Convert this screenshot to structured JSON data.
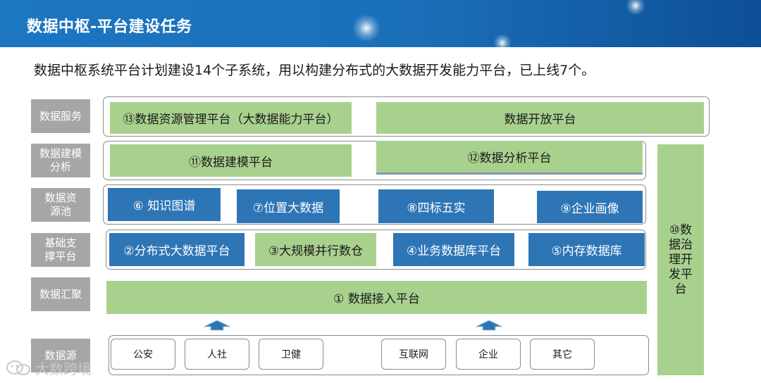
{
  "header": {
    "title": "数据中枢-平台建设任务"
  },
  "subtitle": "数据中枢系统平台计划建设14个子系统，用以构建分布式的大数据开发能力平台，已上线7个。",
  "layers": {
    "service": "数据服务",
    "modeling": "数据建模分析",
    "resource": "数据资源池",
    "foundation": "基础支撑平台",
    "aggregation": "数据汇聚",
    "source": "数据源"
  },
  "boxes": {
    "b13": "⑬数据资源管理平台（大数据能力平台）",
    "open": "数据开放平台",
    "b11": "⑪数据建模平台",
    "b12": "⑫数据分析平台",
    "b6": "⑥ 知识图谱",
    "b7": "⑦位置大数据",
    "b8": "⑧四标五实",
    "b9": "⑨企业画像",
    "b2": "②分布式大数据平台",
    "b3": "③大规模并行数仓",
    "b4": "④业务数据库平台",
    "b5": "⑤内存数据库",
    "b1": "① 数据接入平台",
    "b10": "⑩数据治理开发平台"
  },
  "sources": [
    "公安",
    "人社",
    "卫健",
    "互联网",
    "企业",
    "其它"
  ],
  "watermark": "大数跨境",
  "colors": {
    "header_blue": "#1d76c2",
    "green": "#a9d18e",
    "blue": "#2e75b6",
    "label_gray": "#a6a6a6"
  }
}
